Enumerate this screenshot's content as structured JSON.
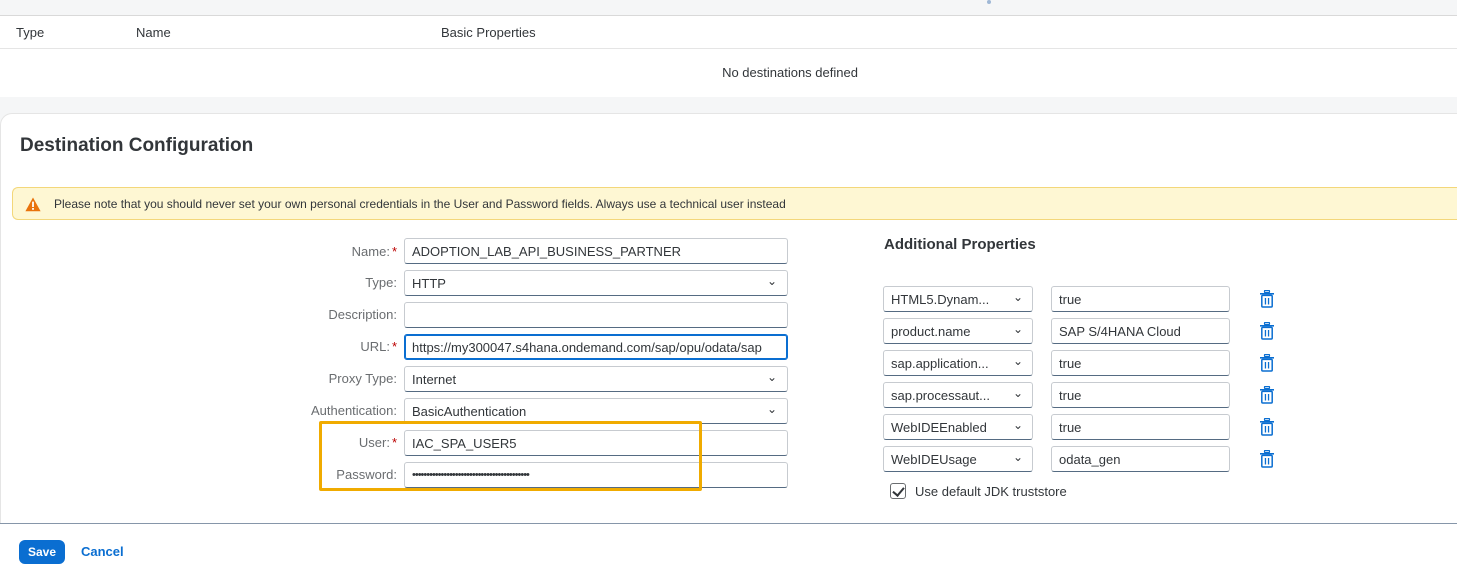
{
  "table": {
    "headers": [
      "Type",
      "Name",
      "Basic Properties"
    ],
    "empty_text": "No destinations defined"
  },
  "panel": {
    "title": "Destination Configuration",
    "warning": "Please note that you should never set your own personal credentials in the User and Password fields. Always use a technical user instead"
  },
  "form": {
    "name_label": "Name:",
    "name_value": "ADOPTION_LAB_API_BUSINESS_PARTNER",
    "type_label": "Type:",
    "type_value": "HTTP",
    "description_label": "Description:",
    "description_value": "",
    "url_label": "URL:",
    "url_value": "https://my300047.s4hana.ondemand.com/sap/opu/odata/sap",
    "proxy_label": "Proxy Type:",
    "proxy_value": "Internet",
    "auth_label": "Authentication:",
    "auth_value": "BasicAuthentication",
    "user_label": "User:",
    "user_value": "IAC_SPA_USER5",
    "password_label": "Password:",
    "password_value": "•••••••••••••••••••••••••••••••••••••••••",
    "required_mark": "*"
  },
  "additional": {
    "title": "Additional Properties",
    "rows": [
      {
        "key": "HTML5.Dynam...",
        "value": "true"
      },
      {
        "key": "product.name",
        "value": "SAP S/4HANA Cloud"
      },
      {
        "key": "sap.application...",
        "value": "true"
      },
      {
        "key": "sap.processaut...",
        "value": "true"
      },
      {
        "key": "WebIDEEnabled",
        "value": "true"
      },
      {
        "key": "WebIDEUsage",
        "value": "odata_gen"
      }
    ],
    "jdk_label": "Use default JDK truststore"
  },
  "footer": {
    "save_label": "Save",
    "cancel_label": "Cancel"
  },
  "colors": {
    "accent": "#0a6ed1",
    "warning_bg": "#fef7d3",
    "highlight": "#f0ab00",
    "required": "#bb0000"
  },
  "icons": {
    "warning": "warning-icon",
    "delete": "trash-icon",
    "dropdown": "chevron-down-icon"
  }
}
